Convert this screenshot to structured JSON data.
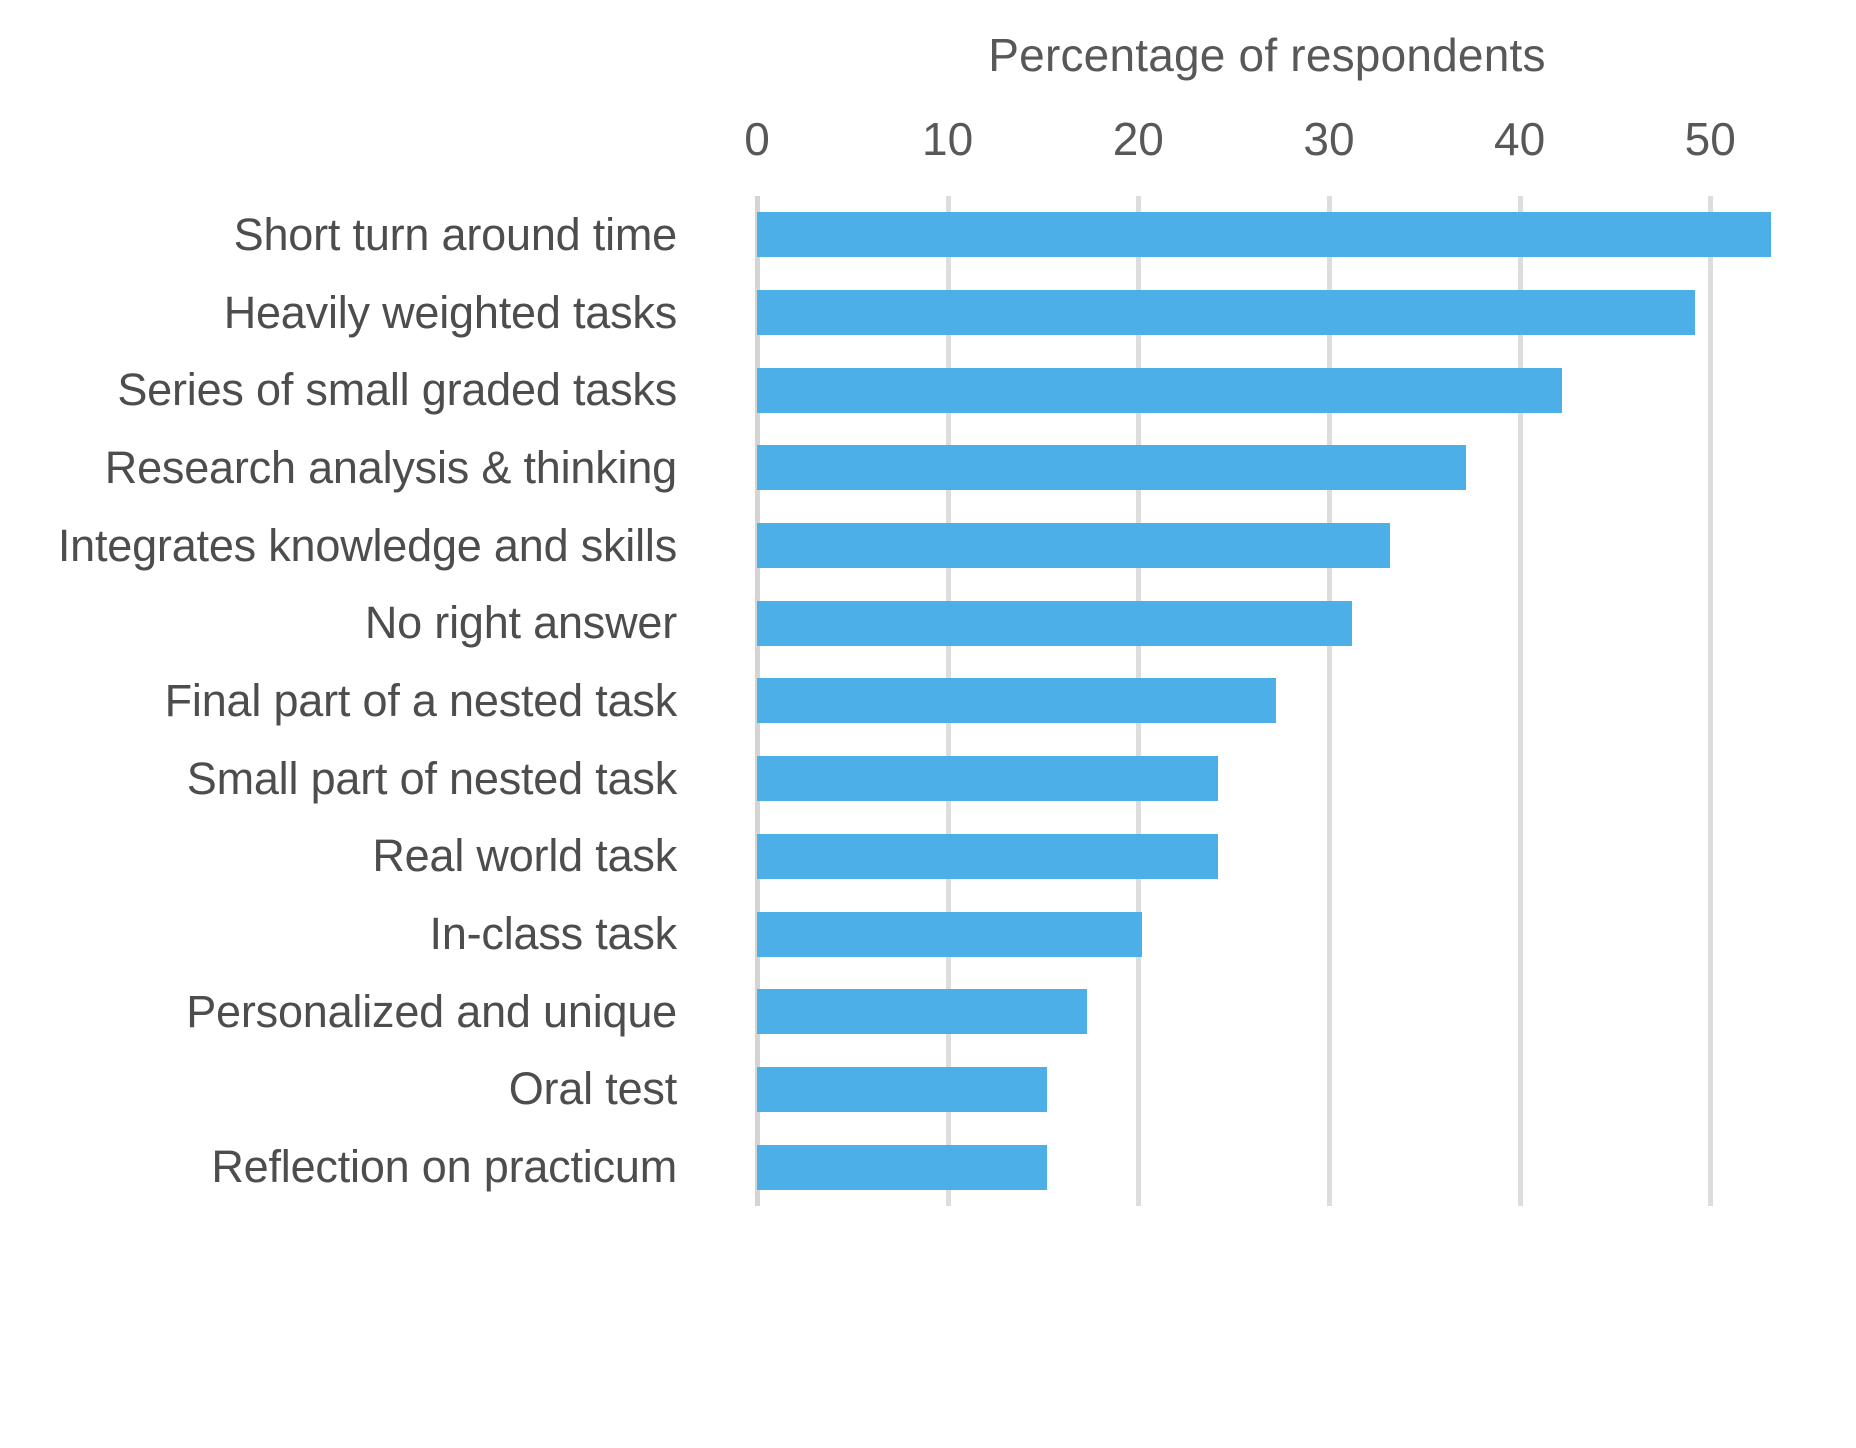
{
  "chart_data": {
    "type": "bar",
    "orientation": "horizontal",
    "title": "",
    "xlabel": "Percentage of respondents",
    "ylabel": "",
    "xlim": [
      0,
      53.5
    ],
    "xticks": [
      0,
      10,
      20,
      30,
      40,
      50
    ],
    "xtick_labels": [
      "0",
      "10",
      "20",
      "30",
      "40",
      "50"
    ],
    "grid": "vertical",
    "legend": "none",
    "bar_color": "#4CAFE8",
    "text_color": "#4d4d4d",
    "gridline_color": "#dddddd",
    "categories": [
      "Short turn around time",
      "Heavily weighted tasks",
      "Series of small graded tasks",
      "Research analysis & thinking",
      "Integrates knowledge and skills",
      "No right answer",
      "Final part of a nested task",
      "Small part of nested task",
      "Real world task",
      "In-class task",
      "Personalized and unique",
      "Oral test",
      "Reflection on practicum"
    ],
    "values": [
      53.2,
      49.2,
      42.2,
      37.2,
      33.2,
      31.2,
      27.2,
      24.2,
      24.2,
      20.2,
      17.3,
      15.2,
      15.2
    ]
  }
}
